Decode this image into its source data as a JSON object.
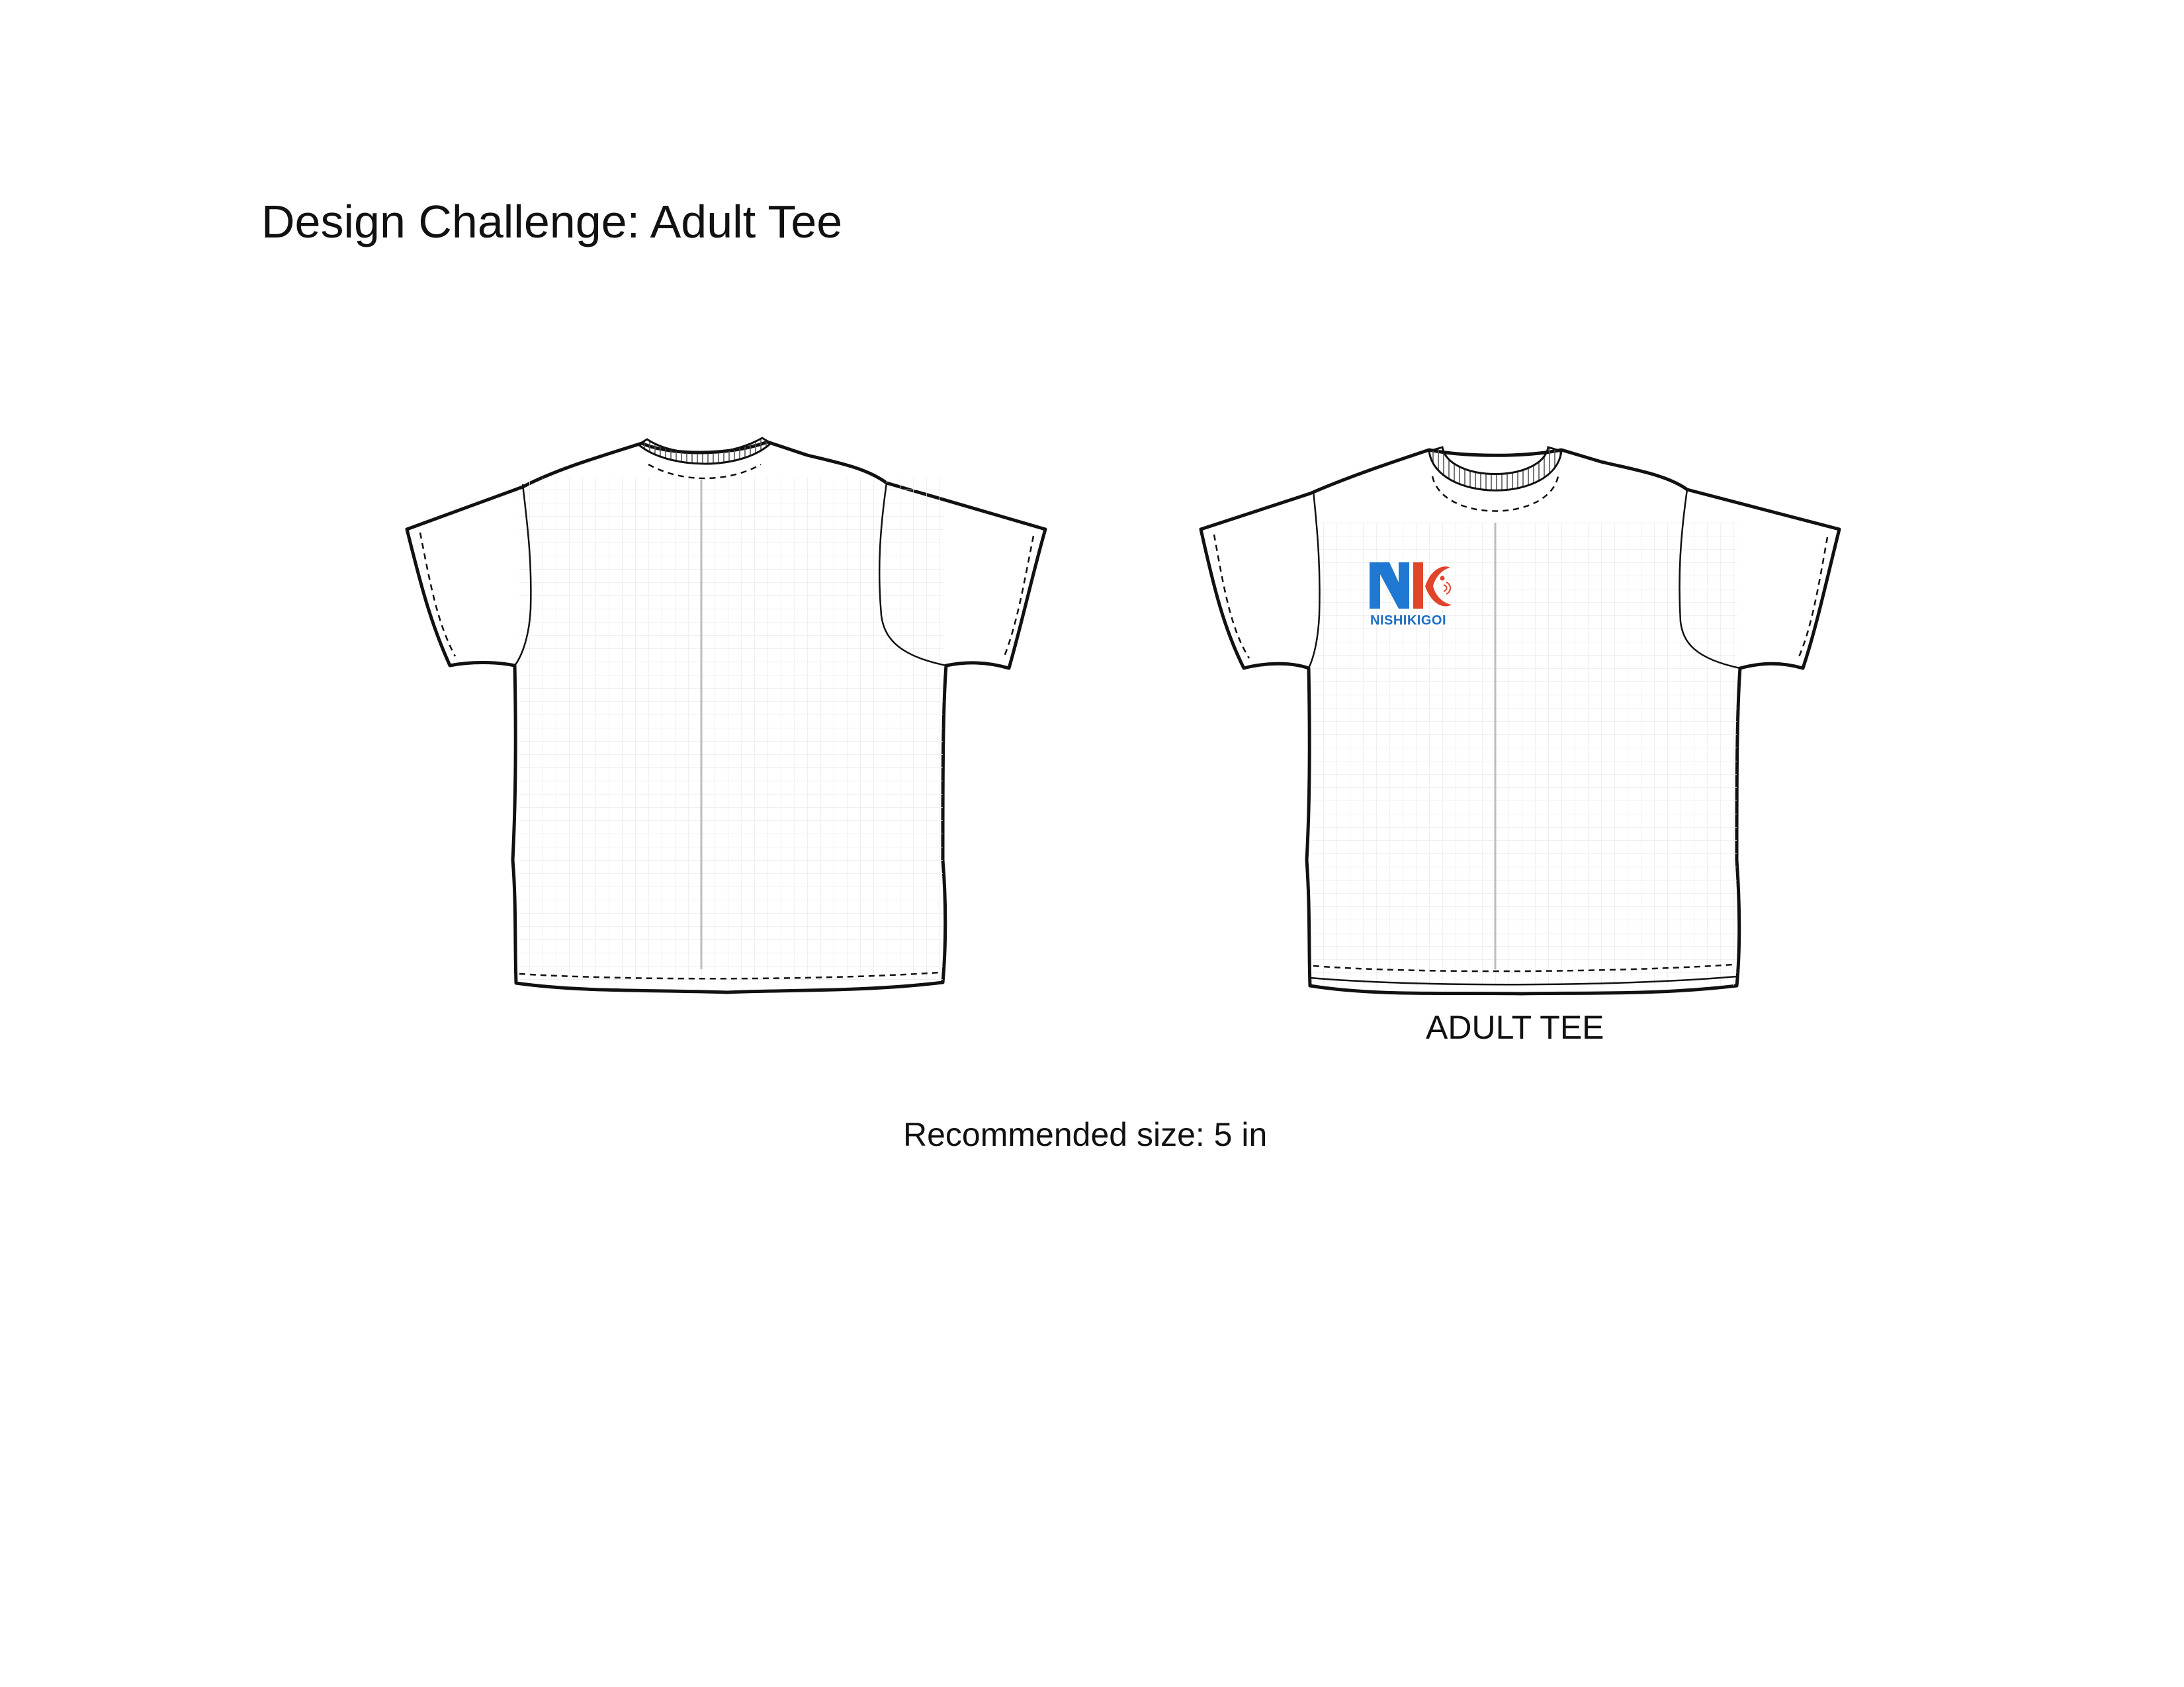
{
  "header": {
    "title": "Design Challenge: Adult Tee"
  },
  "front_tee": {
    "logo": {
      "monogram": "NK",
      "wordmark": "NISHIKIGOI",
      "colors": {
        "blue": "#1f78d1",
        "red": "#e0452b"
      }
    },
    "label": "ADULT TEE"
  },
  "recommendation": {
    "text": "Recommended size: 5 in"
  },
  "colors": {
    "outline": "#111111",
    "grid": "#ececec",
    "center_line": "#bdbdbd",
    "background": "#ffffff"
  }
}
